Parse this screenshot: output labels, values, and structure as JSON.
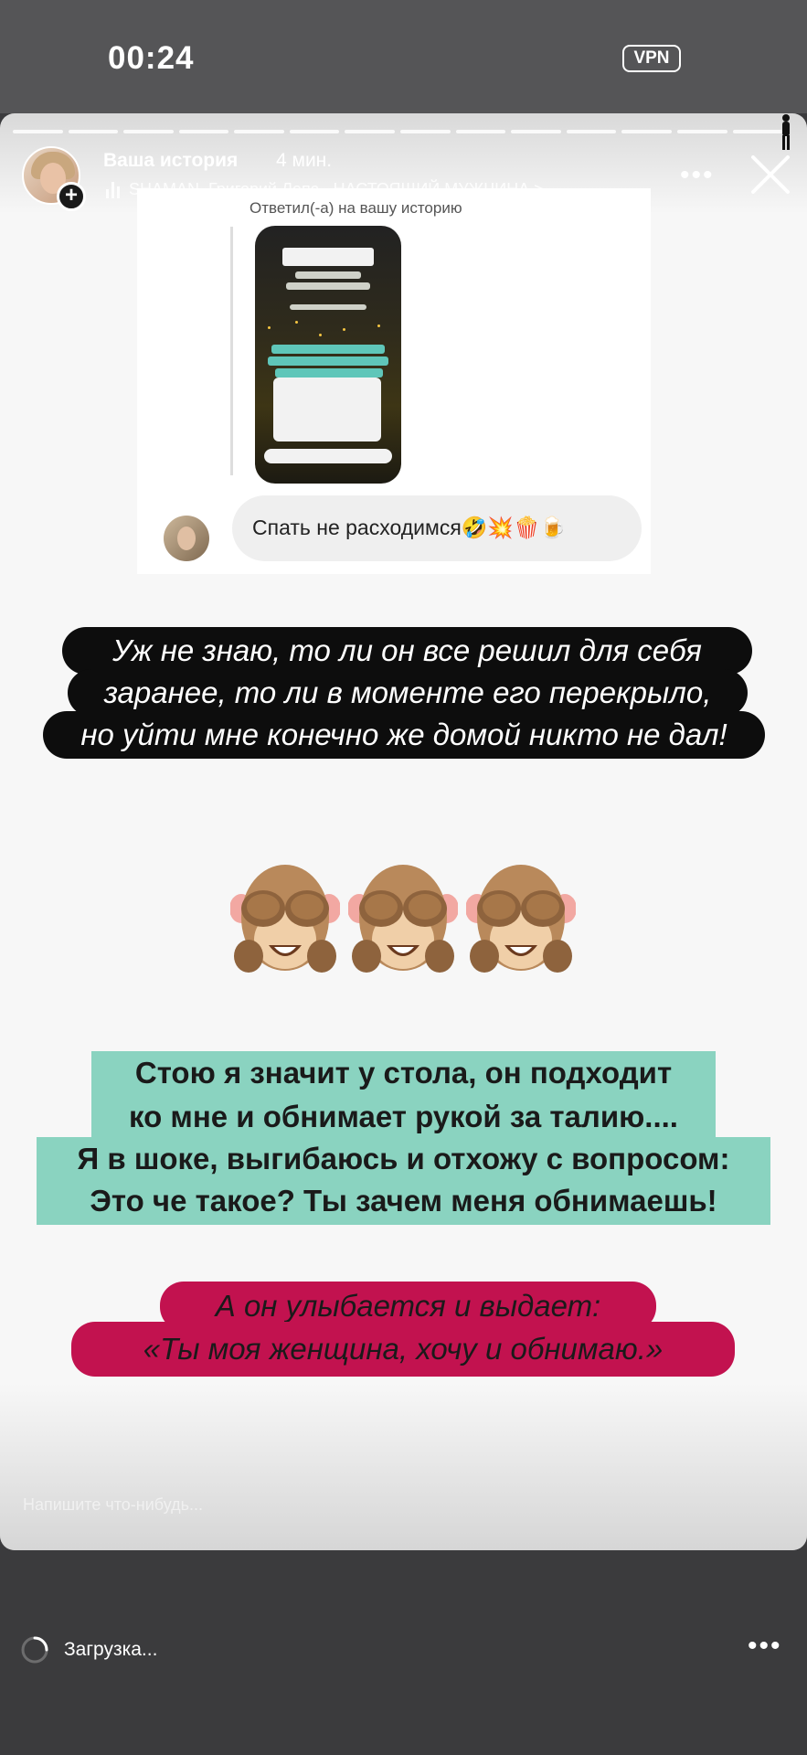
{
  "status_bar": {
    "time": "00:24",
    "vpn_label": "VPN"
  },
  "story": {
    "progress_segments": 14,
    "username": "Ваша история",
    "time_ago": "4 мин.",
    "music": "SHAMAN, Григорий Лепс · НАСТОЯЩИЙ МУЖЧИНА >",
    "screenshot": {
      "replied_label": "Ответил(-а) на вашу историю",
      "message": "Спать не расходимся🤣💥🍿🍺"
    },
    "caption_1": [
      "Уж не знаю, то ли он все решил для себя",
      "заранее, то ли в моменте его перекрыло,",
      "но уйти мне конечно же домой никто не дал!"
    ],
    "monkeys": [
      "🙈",
      "🙈",
      "🙈"
    ],
    "caption_2": [
      "Стою я значит у стола, он подходит",
      "ко мне и обнимает рукой за талию....",
      "Я в шоке, выгибаюсь и отхожу с вопросом:",
      "Это че такое? Ты зачем меня обнимаешь!"
    ],
    "caption_3": [
      "А он улыбается и выдает:",
      "«Ты моя женщина, хочу и обнимаю.»"
    ],
    "reply_placeholder": "Напишите что-нибудь..."
  },
  "bottom_bar": {
    "loading_text": "Загрузка..."
  },
  "colors": {
    "caption_green": "#8ad3c0",
    "caption_pink": "#c2124f",
    "caption_black": "#0d0d0d"
  }
}
